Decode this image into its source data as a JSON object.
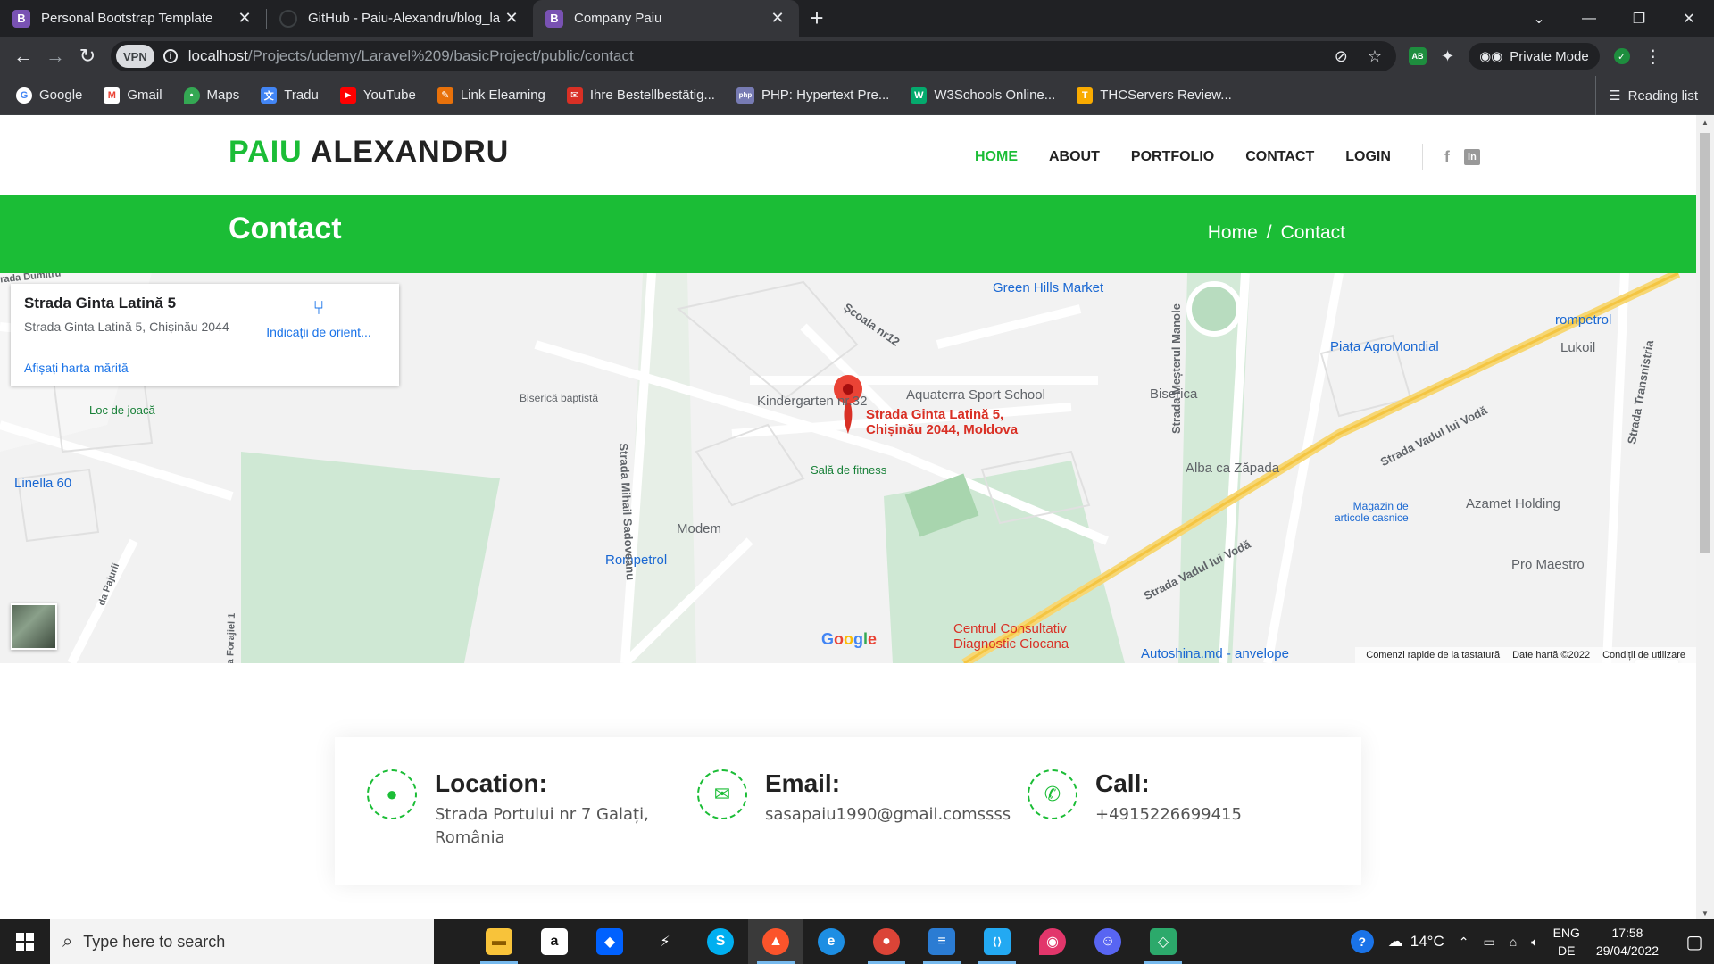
{
  "browser": {
    "tabs": [
      {
        "title": "Personal Bootstrap Template",
        "favicon": "B"
      },
      {
        "title": "GitHub - Paiu-Alexandru/blog_la",
        "favicon": ""
      },
      {
        "title": "Company Paiu",
        "favicon": "B"
      }
    ],
    "vpn_label": "VPN",
    "url_host": "localhost",
    "url_path": "/Projects/udemy/Laravel%209/basicProject/public/contact",
    "private_mode_label": "Private Mode",
    "extension_badge": "AB",
    "bookmarks": [
      {
        "label": "Google",
        "color": "#4285f4",
        "icon": "G"
      },
      {
        "label": "Gmail",
        "color": "#ea4335",
        "icon": "M"
      },
      {
        "label": "Maps",
        "color": "#34a853",
        "icon": "•"
      },
      {
        "label": "Tradu",
        "color": "#4285f4",
        "icon": "文"
      },
      {
        "label": "YouTube",
        "color": "#ff0000",
        "icon": "▶"
      },
      {
        "label": "Link Elearning",
        "color": "#e8710a",
        "icon": "✎"
      },
      {
        "label": "Ihre Bestellbestätig...",
        "color": "#d93025",
        "icon": "✉"
      },
      {
        "label": "PHP: Hypertext Pre...",
        "color": "#777bb3",
        "icon": "php"
      },
      {
        "label": "W3Schools Online...",
        "color": "#04aa6d",
        "icon": "W"
      },
      {
        "label": "THCServers Review...",
        "color": "#f9ab00",
        "icon": "T"
      }
    ],
    "reading_list_label": "Reading list"
  },
  "site": {
    "logo_accent": "PAIU",
    "logo_rest": " ALEXANDRU",
    "nav": [
      "HOME",
      "ABOUT",
      "PORTFOLIO",
      "CONTACT",
      "LOGIN"
    ],
    "accent_color": "#1bbd36",
    "page_title": "Contact",
    "breadcrumb": {
      "home": "Home",
      "sep": "/",
      "current": "Contact"
    }
  },
  "map": {
    "card": {
      "place": "Strada Ginta Latină 5",
      "address": "Strada Ginta Latină 5, Chișinău 2044",
      "directions": "Indicații de orient...",
      "larger_map": "Afișați harta mărită"
    },
    "pin_label_line1": "Strada Ginta Latină 5,",
    "pin_label_line2": "Chișinău 2044, Moldova",
    "labels": {
      "green_hills": "Green Hills Market",
      "scoala": "Școala nr12",
      "rompetrol_top": "rompetrol",
      "piata": "Piața AgroMondial",
      "lukoil": "Lukoil",
      "biserica_baptista": "Biserică baptistă",
      "kindergarten": "Kindergarten nr.32",
      "aquaterra": "Aquaterra Sport School",
      "biserica": "Biserica",
      "loc_joaca": "Loc de joacă",
      "linella": "Linella 60",
      "sala_fitness": "Sală de fitness",
      "alba": "Alba ca Zăpada",
      "magazin_1": "Magazin de",
      "magazin_2": "articole casnice",
      "azamet": "Azamet Holding",
      "modem": "Modem",
      "rompetrol_bottom": "Rompetrol",
      "pro_maestro": "Pro Maestro",
      "centru_1": "Centrul Consultativ",
      "centru_2": "Diagnostic Ciocana",
      "autoshina": "Autoshina.md - anvelope",
      "str_mesterul": "Strada Meșterul Manole",
      "str_vadul_1": "Strada Vadul lui Vodă",
      "str_vadul_2": "Strada Vadul lui Vodă",
      "str_sadoveanu": "Strada Mihail Sadoveanu",
      "str_transnistria": "Strada Transnistria",
      "str_dumitru": "rada Dumitru",
      "str_pajurii": "da Pajurii",
      "str_forajiei": "a Forajiei 1"
    },
    "google_logo": "Google",
    "footer": [
      "Comenzi rapide de la tastatură",
      "Date hartă ©2022",
      "Condiții de utilizare"
    ],
    "zoom_in": "+",
    "zoom_out": "−"
  },
  "contact_info": {
    "location": {
      "title": "Location:",
      "line1": "Strada Portului nr 7 Galați,",
      "line2": "România"
    },
    "email": {
      "title": "Email:",
      "value": "sasapaiu1990@gmail.comssss"
    },
    "call": {
      "title": "Call:",
      "value": "+4915226699415"
    }
  },
  "taskbar": {
    "search_placeholder": "Type here to search",
    "apps": [
      {
        "name": "file-explorer",
        "color": "#f8c33a",
        "glyph": "▬"
      },
      {
        "name": "amazon",
        "color": "#ffffff",
        "glyph": "a"
      },
      {
        "name": "dropbox",
        "color": "#0061ff",
        "glyph": "◆"
      },
      {
        "name": "app-bolt",
        "color": "#1f1f1f",
        "glyph": "⚡"
      },
      {
        "name": "skype",
        "color": "#00aff0",
        "glyph": "S"
      },
      {
        "name": "brave",
        "color": "#fb542b",
        "glyph": "▲"
      },
      {
        "name": "edge",
        "color": "#1d8ee3",
        "glyph": "e"
      },
      {
        "name": "chrome",
        "color": "#db4437",
        "glyph": "●"
      },
      {
        "name": "notepad",
        "color": "#2b7cd3",
        "glyph": "≡"
      },
      {
        "name": "vscode",
        "color": "#23a9f2",
        "glyph": "⟨⟩"
      },
      {
        "name": "paint",
        "color": "#e2366b",
        "glyph": "◉"
      },
      {
        "name": "discord",
        "color": "#5865f2",
        "glyph": "☺"
      },
      {
        "name": "sourcetree",
        "color": "#2ca96b",
        "glyph": "◇"
      }
    ],
    "weather": "14°C",
    "lang_1": "ENG",
    "lang_2": "DE",
    "time": "17:58",
    "date": "29/04/2022"
  }
}
